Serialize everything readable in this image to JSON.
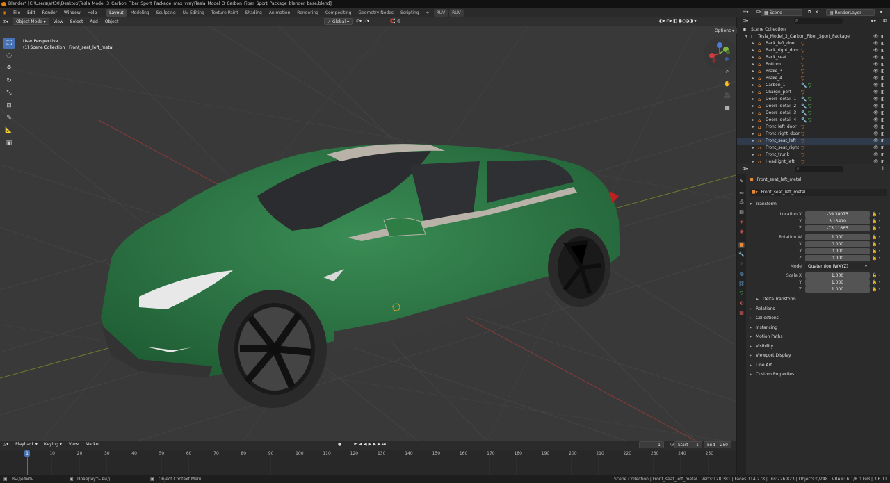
{
  "titlebar": {
    "text": "Blender* [C:\\Users\\art30\\Desktop\\Tesla_Model_3_Carbon_Fiber_Sport_Package_max_vray\\Tesla_Model_3_Carbon_Fiber_Sport_Package_blender_base.blend]"
  },
  "menu": {
    "items": [
      "File",
      "Edit",
      "Render",
      "Window",
      "Help"
    ]
  },
  "workspaces": [
    "Layout",
    "Modeling",
    "Sculpting",
    "UV Editing",
    "Texture Paint",
    "Shading",
    "Animation",
    "Rendering",
    "Compositing",
    "Geometry Nodes",
    "Scripting"
  ],
  "workspace_extra": [
    "+",
    "RUV",
    "RUV"
  ],
  "scene": {
    "label": "Scene",
    "render_layer": "RenderLayer"
  },
  "viewport": {
    "mode": "Object Mode",
    "menus": [
      "View",
      "Select",
      "Add",
      "Object"
    ],
    "orientation": "Global",
    "perspective": "User Perspective",
    "collection_info": "(1) Scene Collection | Front_seat_left_metal",
    "options": "Options"
  },
  "outliner": {
    "root": "Scene Collection",
    "collection": "Tesla_Model_3_Carbon_Fiber_Sport_Package",
    "items": [
      "Back_left_door",
      "Back_right_door",
      "Back_seat",
      "Bottom",
      "Brake_3",
      "Brake_4",
      "Carbon_1",
      "Charge_port",
      "Doors_detail_1",
      "Doors_detail_2",
      "Doors_detail_3",
      "Doors_detail_4",
      "Front_left_door",
      "Front_right_door",
      "Front_seat_left",
      "Front_seat_right",
      "Front_trunk",
      "Headlight_left"
    ]
  },
  "properties": {
    "object": "Front_seat_left_metal",
    "object_data": "Front_seat_left_metal",
    "transform": {
      "title": "Transform",
      "location_label": "Location X",
      "location": [
        "-39.38075",
        "3.13410",
        "-73.11665"
      ],
      "rotation_label": "Rotation W",
      "rotation": [
        "1.000",
        "0.000",
        "0.000",
        "0.000"
      ],
      "mode_label": "Mode",
      "mode": "Quaternion (WXYZ)",
      "scale_label": "Scale X",
      "scale": [
        "1.000",
        "1.000",
        "1.000"
      ],
      "axis_y": "Y",
      "axis_z": "Z",
      "axis_x": "X"
    },
    "sections": [
      "Delta Transform",
      "Relations",
      "Collections",
      "Instancing",
      "Motion Paths",
      "Visibility",
      "Viewport Display",
      "Line Art",
      "Custom Properties"
    ]
  },
  "timeline": {
    "menus": [
      "Playback",
      "Keying",
      "View",
      "Marker"
    ],
    "current_frame": "1",
    "start_label": "Start",
    "start": "1",
    "end_label": "End",
    "end": "250",
    "ticks": [
      "1",
      "10",
      "20",
      "30",
      "40",
      "50",
      "60",
      "70",
      "80",
      "90",
      "100",
      "110",
      "120",
      "130",
      "140",
      "150",
      "160",
      "170",
      "180",
      "190",
      "200",
      "210",
      "220",
      "230",
      "240",
      "250"
    ]
  },
  "status": {
    "select": "Выделить",
    "rotate": "Повернуть вид",
    "context": "Object Context Menu",
    "stats": "Scene Collection | Front_seat_left_metal | Verts:128,381 | Faces:114,278 | Tris:226,823 | Objects:0/248 | VRAM: 6.1/8.0 GiB | 3.6.11"
  },
  "colors": {
    "car_body": "#2e7d45",
    "accent": "#4772b3",
    "object_orange": "#e88a3a"
  }
}
